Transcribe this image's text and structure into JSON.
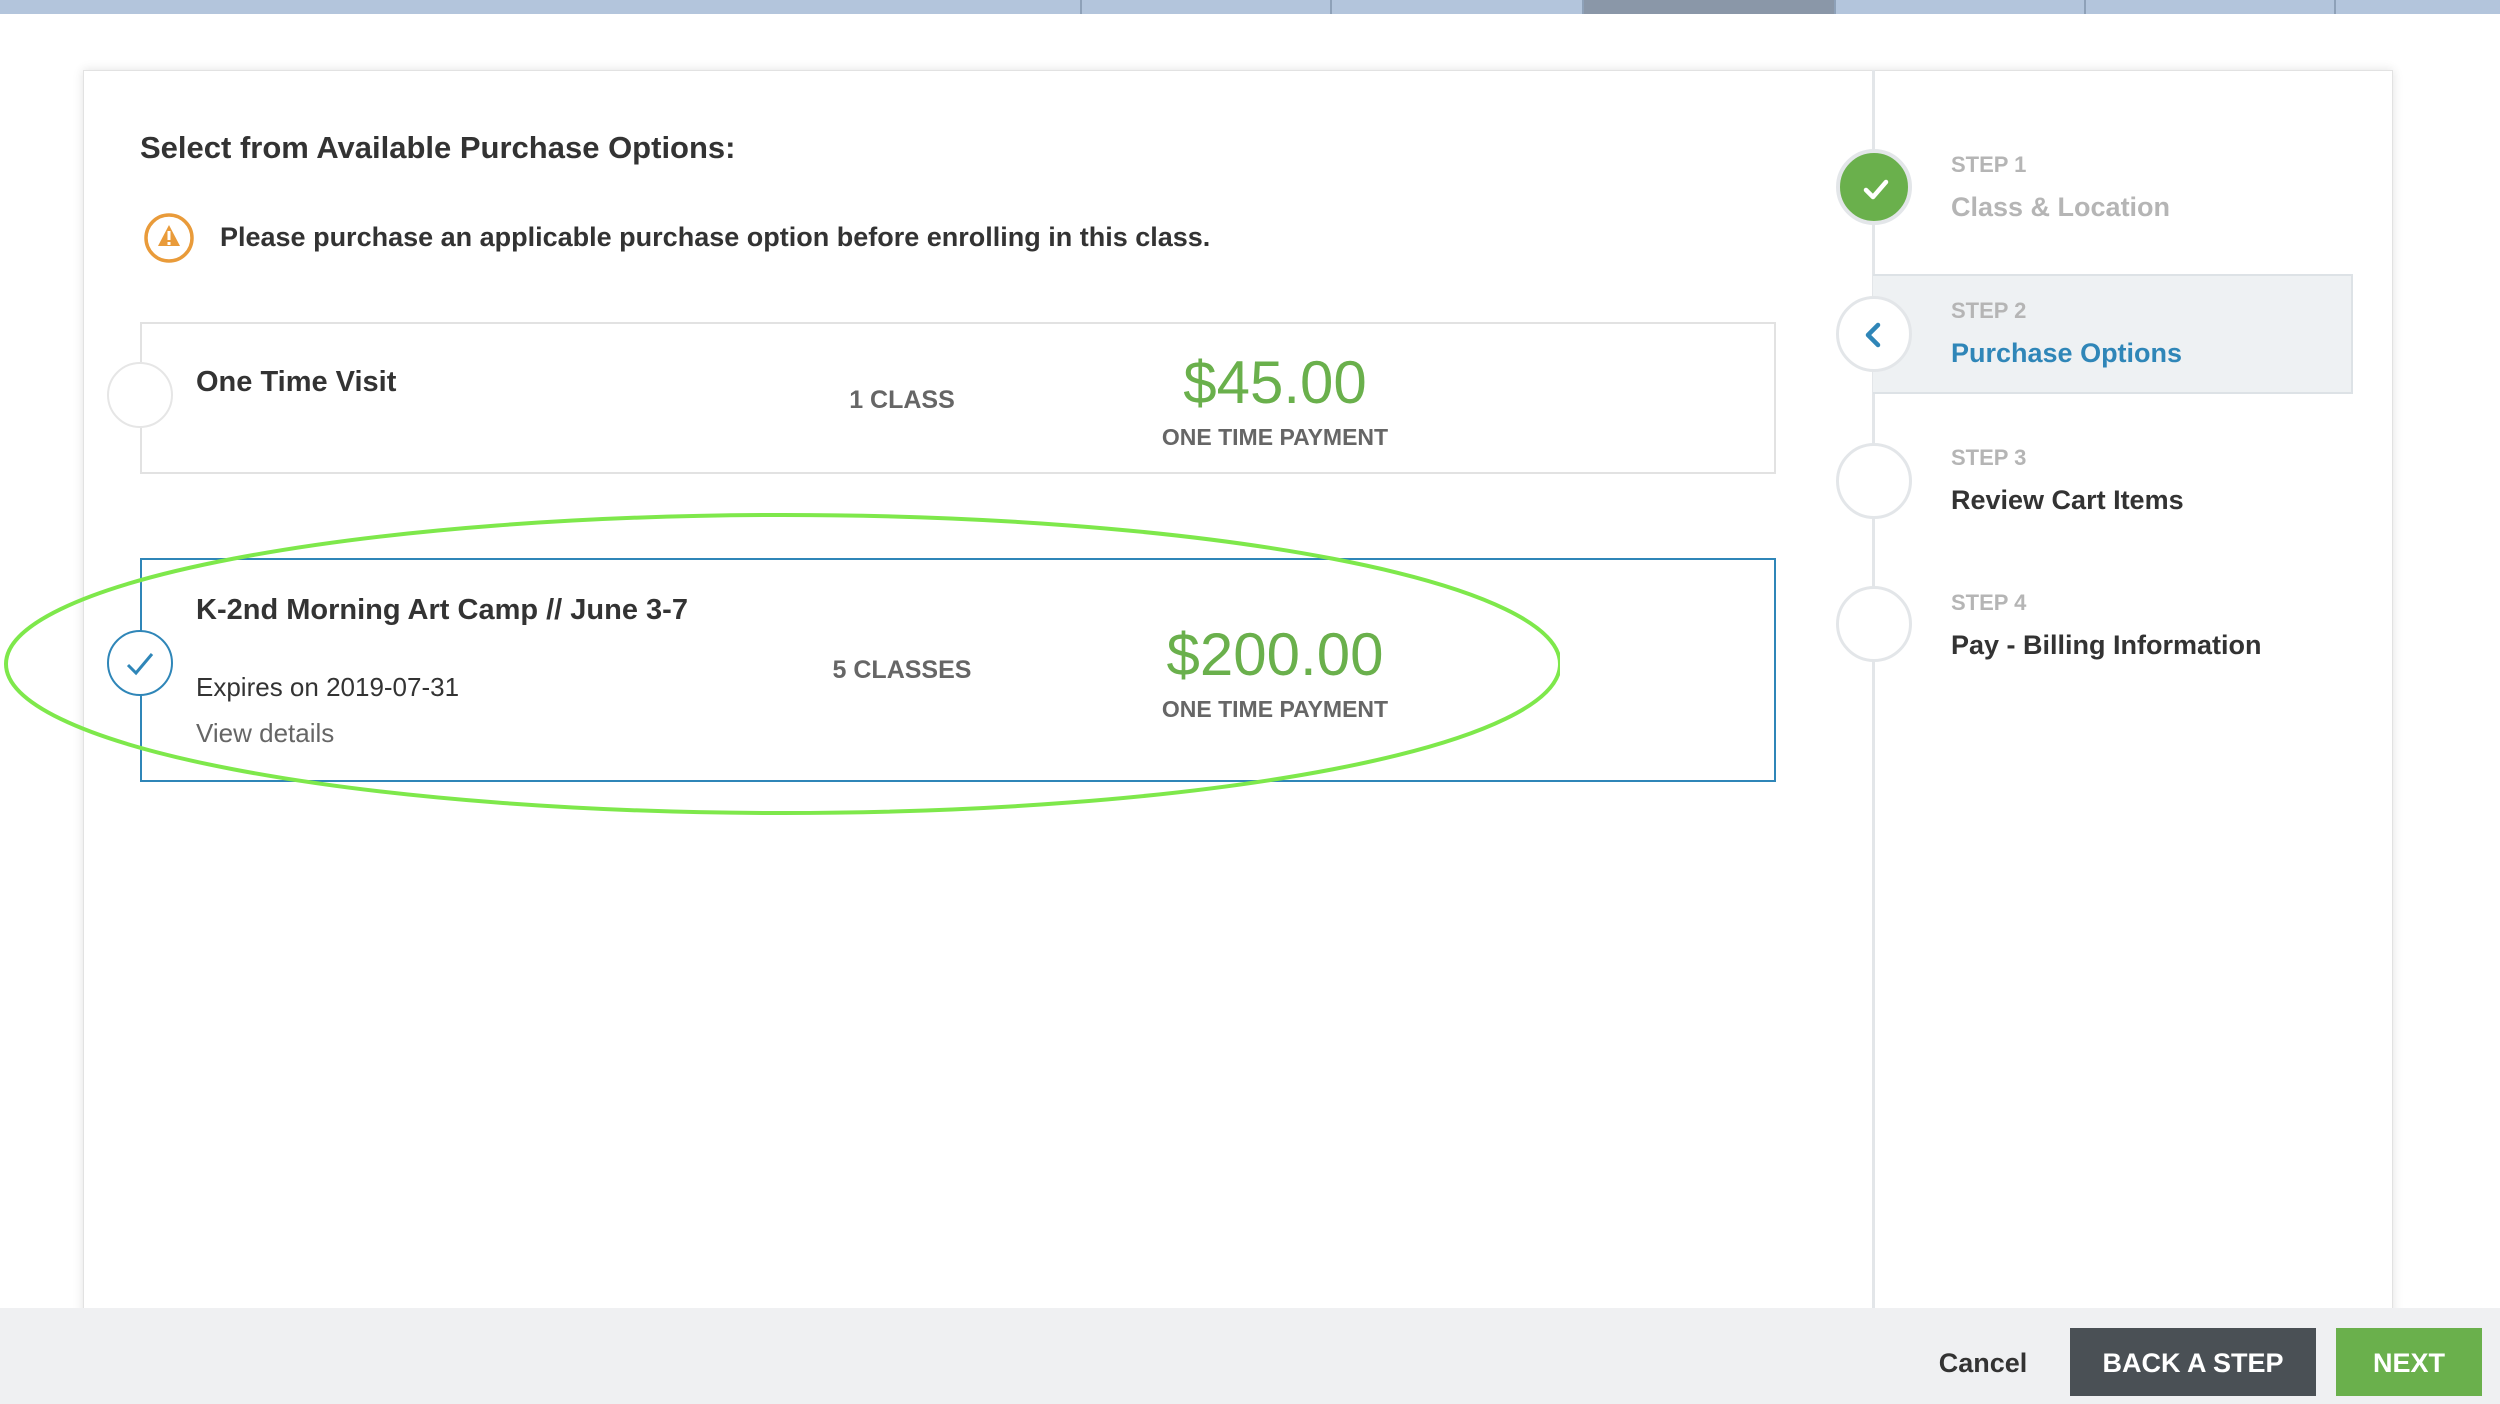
{
  "colors": {
    "accent_blue": "#2f86b8",
    "price_green": "#6ab04c",
    "highlight_ellipse": "#7ee84b",
    "warning_orange": "#e99b3a"
  },
  "page": {
    "heading": "Select from Available Purchase Options:",
    "warning": {
      "icon": "warning-icon",
      "text": "Please purchase an applicable purchase option before enrolling in this class."
    }
  },
  "options": [
    {
      "name": "One Time Visit",
      "classes": "1 CLASS",
      "price": "$45.00",
      "payment_term": "ONE TIME PAYMENT",
      "selected": false
    },
    {
      "name": "K-2nd Morning Art Camp // June 3-7",
      "expires": "Expires on 2019-07-31",
      "details_link": "View details",
      "classes": "5 CLASSES",
      "price": "$200.00",
      "payment_term": "ONE TIME PAYMENT",
      "selected": true
    }
  ],
  "steps": [
    {
      "number": "STEP 1",
      "title": "Class & Location",
      "state": "complete",
      "icon": "check-icon"
    },
    {
      "number": "STEP 2",
      "title": "Purchase Options",
      "state": "active",
      "icon": "chevron-left-icon"
    },
    {
      "number": "STEP 3",
      "title": "Review Cart Items",
      "state": "pending"
    },
    {
      "number": "STEP 4",
      "title": "Pay - Billing Information",
      "state": "pending"
    }
  ],
  "footer": {
    "cancel_label": "Cancel",
    "back_label": "BACK A STEP",
    "next_label": "NEXT"
  }
}
